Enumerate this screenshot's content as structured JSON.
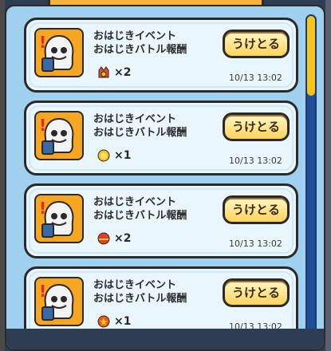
{
  "items": [
    {
      "title1": "おはじきイベント",
      "title2": "おはじきバトル報酬",
      "qty": "×2",
      "time": "10/13 13:02",
      "button": "うけとる",
      "reward_icon": "crown-medal-icon"
    },
    {
      "title1": "おはじきイベント",
      "title2": "おはじきバトル報酬",
      "qty": "×1",
      "time": "10/13 13:02",
      "button": "うけとる",
      "reward_icon": "gold-coin-icon"
    },
    {
      "title1": "おはじきイベント",
      "title2": "おはじきバトル報酬",
      "qty": "×2",
      "time": "10/13 13:02",
      "button": "うけとる",
      "reward_icon": "red-orb-icon"
    },
    {
      "title1": "おはじきイベント",
      "title2": "おはじきバトル報酬",
      "qty": "×1",
      "time": "10/13 13:02",
      "button": "うけとる",
      "reward_icon": "star-orb-icon"
    }
  ],
  "alert_symbol": "!",
  "colors": {
    "panel": "#9fd0ef",
    "button": "#ffd35a",
    "scroll_track": "#1d4f9a",
    "scroll_thumb": "#f7c21a",
    "avatar_bg": "#f6a620"
  }
}
